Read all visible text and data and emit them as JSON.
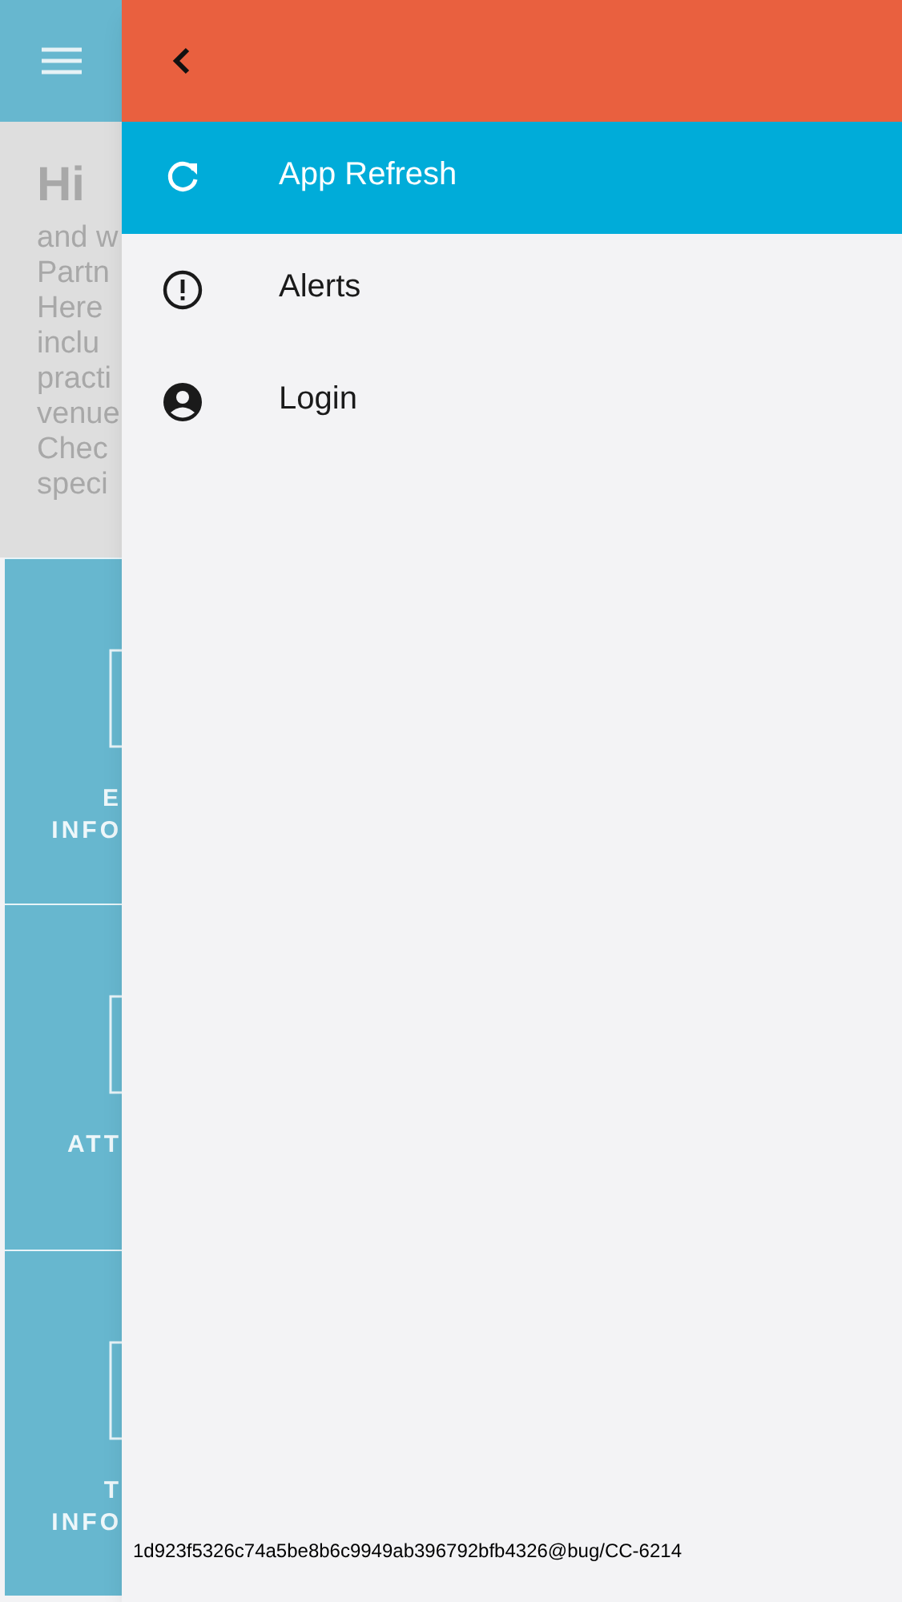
{
  "background_page": {
    "greeting": "Hi",
    "intro_lines": [
      "and w",
      "Partn",
      "Here",
      "inclu",
      "practi",
      "venue",
      "Chec",
      "speci"
    ],
    "tiles": [
      {
        "lines": [
          "E",
          "INFO"
        ]
      },
      {
        "lines": [
          "ATT"
        ]
      },
      {
        "lines": [
          "T",
          "INFO"
        ]
      }
    ]
  },
  "drawer": {
    "items": [
      {
        "kind": "refresh",
        "label": "App Refresh",
        "selected": true
      },
      {
        "kind": "alert",
        "label": "Alerts",
        "selected": false
      },
      {
        "kind": "account",
        "label": "Login",
        "selected": false
      }
    ],
    "footer": "1d923f5326c74a5be8b6c9949ab396792bfb4326@bug/CC-6214"
  }
}
